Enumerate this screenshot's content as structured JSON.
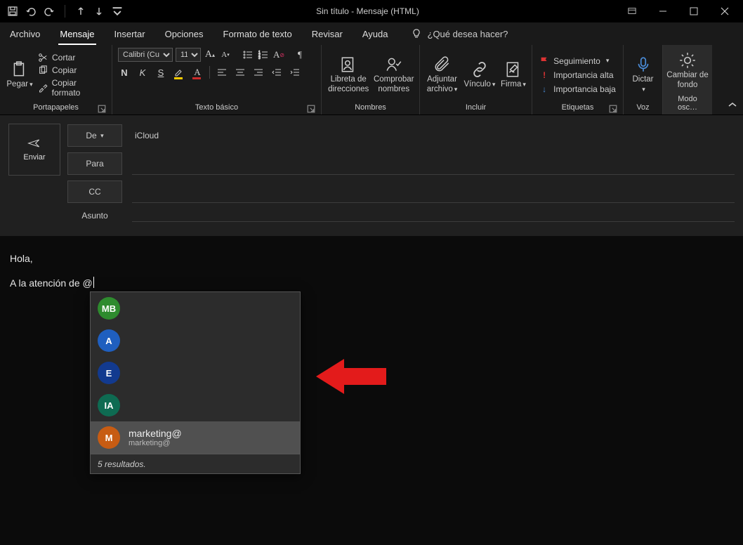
{
  "title": "Sin título  -  Mensaje (HTML)",
  "menu": {
    "archivo": "Archivo",
    "mensaje": "Mensaje",
    "insertar": "Insertar",
    "opciones": "Opciones",
    "formato": "Formato de texto",
    "revisar": "Revisar",
    "ayuda": "Ayuda",
    "tellme": "¿Qué desea hacer?"
  },
  "ribbon": {
    "portapapeles": {
      "label": "Portapapeles",
      "pegar": "Pegar",
      "cortar": "Cortar",
      "copiar": "Copiar",
      "copiar_formato": "Copiar formato"
    },
    "texto_basico": {
      "label": "Texto básico",
      "font_name": "Calibri (Cu",
      "font_size": "11",
      "n": "N",
      "k": "K",
      "s": "S"
    },
    "nombres": {
      "label": "Nombres",
      "libreta": "Libreta de direcciones",
      "comprobar": "Comprobar nombres"
    },
    "incluir": {
      "label": "Incluir",
      "adjuntar": "Adjuntar archivo",
      "vinculo": "Vínculo",
      "firma": "Firma"
    },
    "etiquetas": {
      "label": "Etiquetas",
      "seguimiento": "Seguimiento",
      "importancia_alta": "Importancia alta",
      "importancia_baja": "Importancia baja"
    },
    "voz": {
      "label": "Voz",
      "dictar": "Dictar"
    },
    "modo": {
      "label": "Modo osc…",
      "cambiar": "Cambiar de fondo"
    }
  },
  "compose": {
    "enviar": "Enviar",
    "de": "De",
    "para": "Para",
    "cc": "CC",
    "asunto": "Asunto",
    "account": "iCloud"
  },
  "body": {
    "line1": "Hola,",
    "line2": "A la atención de @"
  },
  "suggestions": {
    "items": [
      {
        "initials": "MB",
        "color": "#2e8b2e",
        "name": "",
        "email": ""
      },
      {
        "initials": "A",
        "color": "#1f5fbf",
        "name": "",
        "email": ""
      },
      {
        "initials": "E",
        "color": "#123a8f",
        "name": "",
        "email": ""
      },
      {
        "initials": "IA",
        "color": "#0e6b52",
        "name": "",
        "email": ""
      },
      {
        "initials": "M",
        "color": "#c75c13",
        "name": "marketing@",
        "email": "marketing@",
        "selected": true
      }
    ],
    "footer": "5 resultados."
  }
}
